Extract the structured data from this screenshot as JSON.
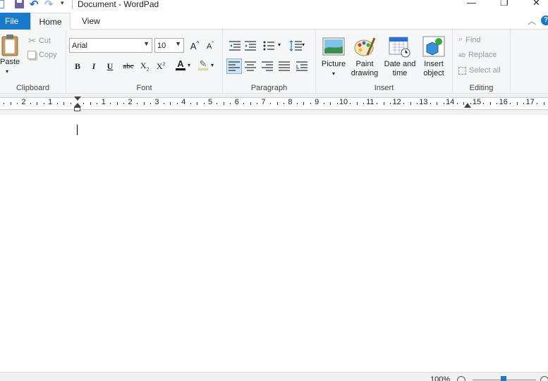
{
  "window": {
    "title": "Document - WordPad",
    "minimize_glyph": "—",
    "restore_glyph": "❐",
    "close_glyph": "✕"
  },
  "tabs": {
    "file": "File",
    "home": "Home",
    "view": "View"
  },
  "ribbon": {
    "clipboard": {
      "label": "Clipboard",
      "paste": "Paste",
      "cut": "Cut",
      "copy": "Copy"
    },
    "font": {
      "label": "Font",
      "family": "Arial",
      "size": "10",
      "bold": "B",
      "italic": "I",
      "underline": "U",
      "strikethrough": "abc",
      "grow": "A",
      "shrink": "A"
    },
    "paragraph": {
      "label": "Paragraph"
    },
    "insert": {
      "label": "Insert",
      "picture": "Picture",
      "paint_drawing": "Paint drawing",
      "date_time": "Date and time",
      "insert_object": "Insert object"
    },
    "editing": {
      "label": "Editing",
      "find": "Find",
      "replace": "Replace",
      "select_all": "Select all"
    }
  },
  "ruler": {
    "numbers": [
      "2",
      "1",
      "1",
      "2",
      "3",
      "4",
      "5",
      "6",
      "7",
      "8",
      "9",
      "10",
      "11",
      "12",
      "13",
      "14",
      "15",
      "16",
      "17"
    ]
  },
  "status": {
    "zoom": "100%"
  },
  "colors": {
    "accent": "#1979ca",
    "ribbon_bg": "#f5f6f7",
    "ruler_bar": "#c7d2df"
  }
}
